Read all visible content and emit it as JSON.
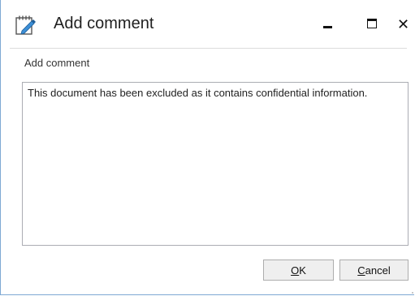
{
  "window": {
    "title": "Add comment",
    "icon": "notepad-pencil-icon",
    "controls": [
      "minimize-icon",
      "maximize-icon",
      "close-icon"
    ],
    "close_glyph": "✕"
  },
  "form": {
    "label": "Add comment",
    "comment_text": "This document has been excluded as it contains confidential information."
  },
  "buttons": {
    "ok_accel": "O",
    "ok_rest": "K",
    "cancel_accel": "C",
    "cancel_rest": "ancel"
  },
  "colors": {
    "window_border": "#7fa9d3",
    "text_box_border": "#abadb3",
    "button_face": "#efefef"
  }
}
